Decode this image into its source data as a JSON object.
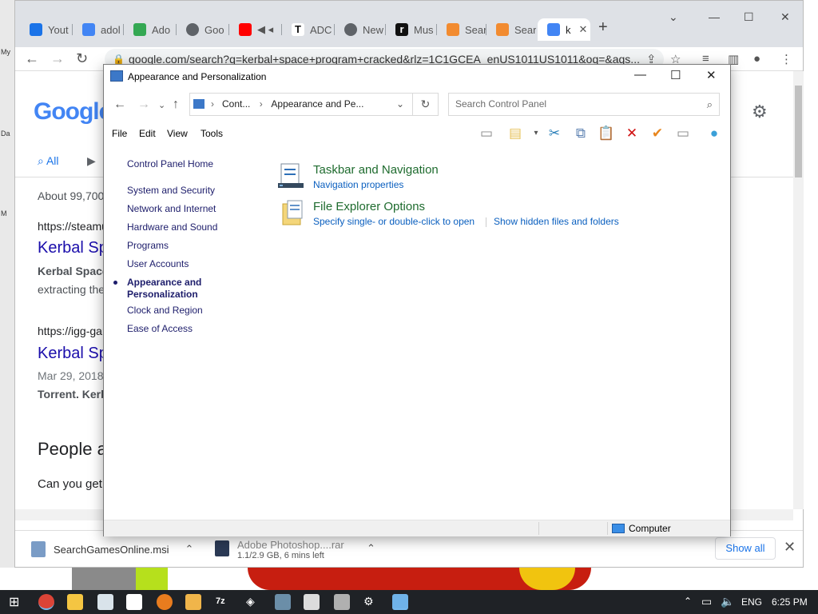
{
  "desktop": {
    "left_labels": [
      "My",
      "Da",
      "M"
    ]
  },
  "browser": {
    "tabs": [
      {
        "label": "Yout",
        "color": "#1a73e8"
      },
      {
        "label": "adol",
        "color": "#4285f4"
      },
      {
        "label": "Ado",
        "color": "#34a853"
      },
      {
        "label": "Goo",
        "color": "#5f6368"
      },
      {
        "label": "",
        "color": "#ff0000"
      },
      {
        "label": "ADC",
        "color": "#111111"
      },
      {
        "label": "New",
        "color": "#5f6368"
      },
      {
        "label": "Mus",
        "color": "#111111"
      },
      {
        "label": "Sear",
        "color": "#f28b30"
      },
      {
        "label": "Sear",
        "color": "#f28b30"
      },
      {
        "label": "k",
        "color": "#4285f4"
      }
    ],
    "url": "google.com/search?q=kerbal+space+program+cracked&rlz=1C1GCEA_enUS1011US1011&oq=&aqs...",
    "downloads": [
      {
        "name": "SearchGamesOnline.msi",
        "detail": ""
      },
      {
        "name": "Adobe Photoshop....rar",
        "detail": "1.1/2.9 GB, 6 mins left"
      }
    ],
    "show_all": "Show all"
  },
  "google": {
    "logo": "Google",
    "tab_all": "All",
    "about": "About 99,700",
    "results": [
      {
        "url": "https://steamu",
        "title": "Kerbal Sp",
        "snippet_bold": "Kerbal Space",
        "snippet": "extracting the"
      },
      {
        "url": "https://igg-gar",
        "title": "Kerbal Sp",
        "date": "Mar 29, 2018",
        "snippet_bold": "Torrent. Kerb"
      }
    ],
    "people_also": "People a",
    "can_you": "Can you get"
  },
  "control_panel": {
    "window_title": "Appearance and Personalization",
    "breadcrumb_1": "Cont...",
    "breadcrumb_2": "Appearance and Pe...",
    "search_placeholder": "Search Control Panel",
    "menu": [
      "File",
      "Edit",
      "View",
      "Tools"
    ],
    "left_nav": [
      {
        "label": "Control Panel Home"
      },
      {
        "label": "System and Security"
      },
      {
        "label": "Network and Internet"
      },
      {
        "label": "Hardware and Sound"
      },
      {
        "label": "Programs"
      },
      {
        "label": "User Accounts"
      },
      {
        "label": "Appearance and Personalization",
        "current": true
      },
      {
        "label": "Clock and Region"
      },
      {
        "label": "Ease of Access"
      }
    ],
    "current_line1": "Appearance and",
    "current_line2": "Personalization",
    "categories": [
      {
        "title": "Taskbar and Navigation",
        "links": [
          "Navigation properties"
        ]
      },
      {
        "title": "File Explorer Options",
        "links": [
          "Specify single- or double-click to open",
          "Show hidden files and folders"
        ]
      }
    ],
    "status_text": "Computer"
  },
  "taskbar": {
    "language": "ENG",
    "time": "6:25 PM"
  }
}
